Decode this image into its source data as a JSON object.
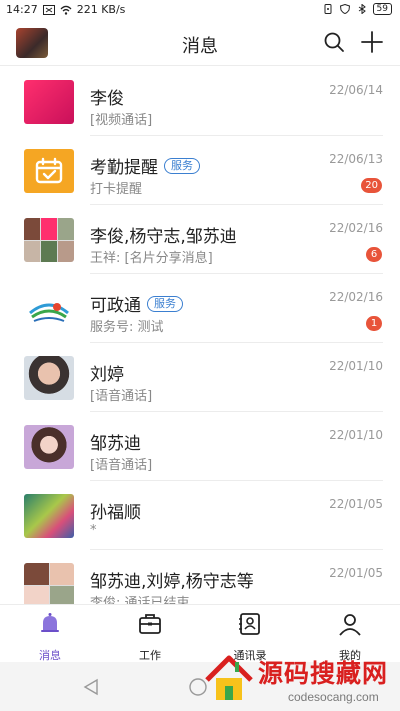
{
  "status_bar": {
    "time": "14:27",
    "speed": "221 KB/s",
    "battery": "59"
  },
  "header": {
    "title": "消息"
  },
  "messages": [
    {
      "name": "李俊",
      "tag": "",
      "sub": "[视频通话]",
      "date": "22/06/14",
      "badge": ""
    },
    {
      "name": "考勤提醒",
      "tag": "服务",
      "sub": "打卡提醒",
      "date": "22/06/13",
      "badge": "20"
    },
    {
      "name": "李俊,杨守志,邹苏迪",
      "tag": "",
      "sub": "王祥: [名片分享消息]",
      "date": "22/02/16",
      "badge": "6"
    },
    {
      "name": "可政通",
      "tag": "服务",
      "sub": "服务号: 测试",
      "date": "22/02/16",
      "badge": "1"
    },
    {
      "name": "刘婷",
      "tag": "",
      "sub": "[语音通话]",
      "date": "22/01/10",
      "badge": ""
    },
    {
      "name": "邹苏迪",
      "tag": "",
      "sub": "[语音通话]",
      "date": "22/01/10",
      "badge": ""
    },
    {
      "name": "孙福顺",
      "tag": "",
      "sub": "*",
      "date": "22/01/05",
      "badge": ""
    },
    {
      "name": "邹苏迪,刘婷,杨守志等",
      "tag": "",
      "sub": "李俊: 通话已结束",
      "date": "22/01/05",
      "badge": ""
    }
  ],
  "tabs": [
    {
      "label": "消息",
      "icon": "bell-icon"
    },
    {
      "label": "工作",
      "icon": "briefcase-icon"
    },
    {
      "label": "通讯录",
      "icon": "contacts-icon"
    },
    {
      "label": "我的",
      "icon": "user-icon"
    }
  ],
  "watermark": {
    "cn": "源码搜藏网",
    "en": "codesocang.com"
  },
  "colors": {
    "accent": "#6b4fc9",
    "badge": "#e8543a",
    "tag": "#3b7fd0"
  }
}
